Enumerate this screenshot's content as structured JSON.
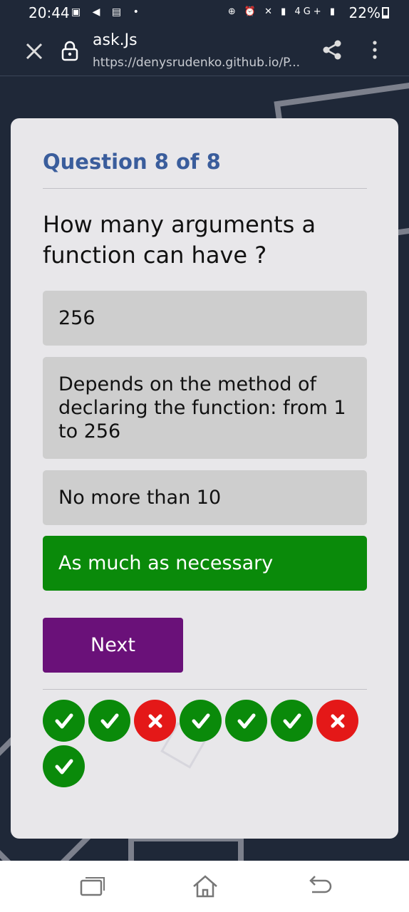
{
  "status": {
    "time": "20:44",
    "left_icons": "▣ ◀ ▤ •",
    "right_icons": "⊕ ⏰ ✕ ▮ 4G+ ▮",
    "battery": "22%"
  },
  "browser": {
    "title": "ask.Js",
    "url": "https://denysrudenko.github.io/P...",
    "icons": [
      "close-icon",
      "lock-icon",
      "share-icon",
      "more-vertical-icon"
    ]
  },
  "quiz": {
    "title": "Question 8 of 8",
    "question": "How many arguments a function can have ?",
    "answers": [
      {
        "label": "256",
        "state": "neutral"
      },
      {
        "label": "Depends on the method of declaring the function: from 1 to 256",
        "state": "neutral"
      },
      {
        "label": "No more than 10",
        "state": "neutral"
      },
      {
        "label": "As much as necessary",
        "state": "correct"
      }
    ],
    "next_label": "Next",
    "results": [
      "correct",
      "correct",
      "wrong",
      "correct",
      "correct",
      "correct",
      "wrong",
      "correct"
    ]
  },
  "colors": {
    "title": "#3a5d9c",
    "correct": "#0a8a0a",
    "wrong": "#e41818",
    "next": "#6a1179",
    "background": "#1f2838"
  },
  "navbar": {
    "icons": [
      "recent-apps-icon",
      "home-icon",
      "back-icon"
    ]
  }
}
